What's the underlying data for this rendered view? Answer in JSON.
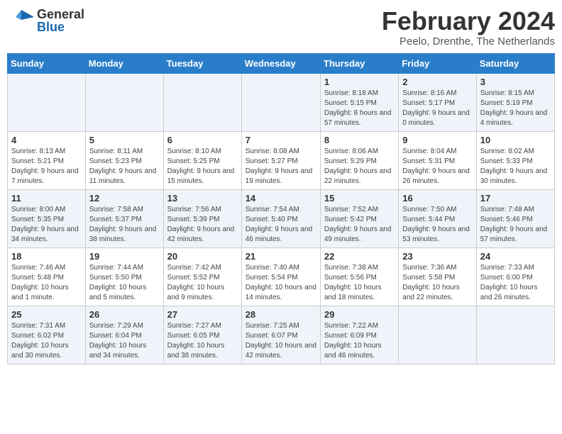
{
  "header": {
    "logo_general": "General",
    "logo_blue": "Blue",
    "month_year": "February 2024",
    "location": "Peelo, Drenthe, The Netherlands"
  },
  "days_of_week": [
    "Sunday",
    "Monday",
    "Tuesday",
    "Wednesday",
    "Thursday",
    "Friday",
    "Saturday"
  ],
  "weeks": [
    [
      {
        "day": "",
        "info": ""
      },
      {
        "day": "",
        "info": ""
      },
      {
        "day": "",
        "info": ""
      },
      {
        "day": "",
        "info": ""
      },
      {
        "day": "1",
        "info": "Sunrise: 8:18 AM\nSunset: 5:15 PM\nDaylight: 8 hours\nand 57 minutes."
      },
      {
        "day": "2",
        "info": "Sunrise: 8:16 AM\nSunset: 5:17 PM\nDaylight: 9 hours\nand 0 minutes."
      },
      {
        "day": "3",
        "info": "Sunrise: 8:15 AM\nSunset: 5:19 PM\nDaylight: 9 hours\nand 4 minutes."
      }
    ],
    [
      {
        "day": "4",
        "info": "Sunrise: 8:13 AM\nSunset: 5:21 PM\nDaylight: 9 hours\nand 7 minutes."
      },
      {
        "day": "5",
        "info": "Sunrise: 8:11 AM\nSunset: 5:23 PM\nDaylight: 9 hours\nand 11 minutes."
      },
      {
        "day": "6",
        "info": "Sunrise: 8:10 AM\nSunset: 5:25 PM\nDaylight: 9 hours\nand 15 minutes."
      },
      {
        "day": "7",
        "info": "Sunrise: 8:08 AM\nSunset: 5:27 PM\nDaylight: 9 hours\nand 19 minutes."
      },
      {
        "day": "8",
        "info": "Sunrise: 8:06 AM\nSunset: 5:29 PM\nDaylight: 9 hours\nand 22 minutes."
      },
      {
        "day": "9",
        "info": "Sunrise: 8:04 AM\nSunset: 5:31 PM\nDaylight: 9 hours\nand 26 minutes."
      },
      {
        "day": "10",
        "info": "Sunrise: 8:02 AM\nSunset: 5:33 PM\nDaylight: 9 hours\nand 30 minutes."
      }
    ],
    [
      {
        "day": "11",
        "info": "Sunrise: 8:00 AM\nSunset: 5:35 PM\nDaylight: 9 hours\nand 34 minutes."
      },
      {
        "day": "12",
        "info": "Sunrise: 7:58 AM\nSunset: 5:37 PM\nDaylight: 9 hours\nand 38 minutes."
      },
      {
        "day": "13",
        "info": "Sunrise: 7:56 AM\nSunset: 5:39 PM\nDaylight: 9 hours\nand 42 minutes."
      },
      {
        "day": "14",
        "info": "Sunrise: 7:54 AM\nSunset: 5:40 PM\nDaylight: 9 hours\nand 46 minutes."
      },
      {
        "day": "15",
        "info": "Sunrise: 7:52 AM\nSunset: 5:42 PM\nDaylight: 9 hours\nand 49 minutes."
      },
      {
        "day": "16",
        "info": "Sunrise: 7:50 AM\nSunset: 5:44 PM\nDaylight: 9 hours\nand 53 minutes."
      },
      {
        "day": "17",
        "info": "Sunrise: 7:48 AM\nSunset: 5:46 PM\nDaylight: 9 hours\nand 57 minutes."
      }
    ],
    [
      {
        "day": "18",
        "info": "Sunrise: 7:46 AM\nSunset: 5:48 PM\nDaylight: 10 hours\nand 1 minute."
      },
      {
        "day": "19",
        "info": "Sunrise: 7:44 AM\nSunset: 5:50 PM\nDaylight: 10 hours\nand 5 minutes."
      },
      {
        "day": "20",
        "info": "Sunrise: 7:42 AM\nSunset: 5:52 PM\nDaylight: 10 hours\nand 9 minutes."
      },
      {
        "day": "21",
        "info": "Sunrise: 7:40 AM\nSunset: 5:54 PM\nDaylight: 10 hours\nand 14 minutes."
      },
      {
        "day": "22",
        "info": "Sunrise: 7:38 AM\nSunset: 5:56 PM\nDaylight: 10 hours\nand 18 minutes."
      },
      {
        "day": "23",
        "info": "Sunrise: 7:36 AM\nSunset: 5:58 PM\nDaylight: 10 hours\nand 22 minutes."
      },
      {
        "day": "24",
        "info": "Sunrise: 7:33 AM\nSunset: 6:00 PM\nDaylight: 10 hours\nand 26 minutes."
      }
    ],
    [
      {
        "day": "25",
        "info": "Sunrise: 7:31 AM\nSunset: 6:02 PM\nDaylight: 10 hours\nand 30 minutes."
      },
      {
        "day": "26",
        "info": "Sunrise: 7:29 AM\nSunset: 6:04 PM\nDaylight: 10 hours\nand 34 minutes."
      },
      {
        "day": "27",
        "info": "Sunrise: 7:27 AM\nSunset: 6:05 PM\nDaylight: 10 hours\nand 38 minutes."
      },
      {
        "day": "28",
        "info": "Sunrise: 7:25 AM\nSunset: 6:07 PM\nDaylight: 10 hours\nand 42 minutes."
      },
      {
        "day": "29",
        "info": "Sunrise: 7:22 AM\nSunset: 6:09 PM\nDaylight: 10 hours\nand 46 minutes."
      },
      {
        "day": "",
        "info": ""
      },
      {
        "day": "",
        "info": ""
      }
    ]
  ]
}
